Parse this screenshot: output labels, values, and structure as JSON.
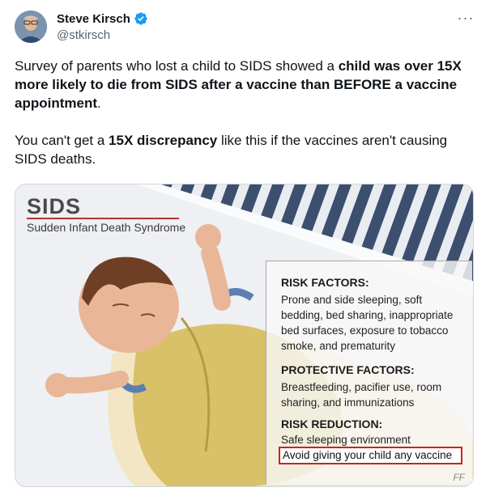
{
  "author": {
    "name": "Steve Kirsch",
    "handle": "@stkirsch"
  },
  "menu": {
    "more_icon": "ellipsis-icon",
    "more_label": "···"
  },
  "tweet": {
    "p1_a": "Survey of parents who lost a child to SIDS showed a ",
    "p1_b": "child was over 15X more likely to die from SIDS after a vaccine than BEFORE a vaccine appointment",
    "p1_c": ".",
    "p2_a": "You can't get a ",
    "p2_b": "15X discrepancy",
    "p2_c": " like this if the vaccines aren't causing SIDS deaths."
  },
  "image": {
    "title": "SIDS",
    "subtitle": "Sudden Infant Death Syndrome",
    "risk_factors_title": "RISK FACTORS:",
    "risk_factors_text": "Prone and side sleeping, soft bedding, bed sharing, inappropriate bed surfaces, exposure to tobacco smoke, and prematurity",
    "protective_title": "PROTECTIVE FACTORS:",
    "protective_text": "Breastfeeding, pacifier use, room sharing, and immunizations",
    "reduction_title": "RISK REDUCTION:",
    "reduction_text": "Safe sleeping environment",
    "overlay_text": "Avoid giving your child any vaccine",
    "signature": "FF",
    "colors": {
      "accent_rule": "#b5332e",
      "highlight_box": "#d11f1f",
      "verified": "#1d9bf0"
    }
  }
}
